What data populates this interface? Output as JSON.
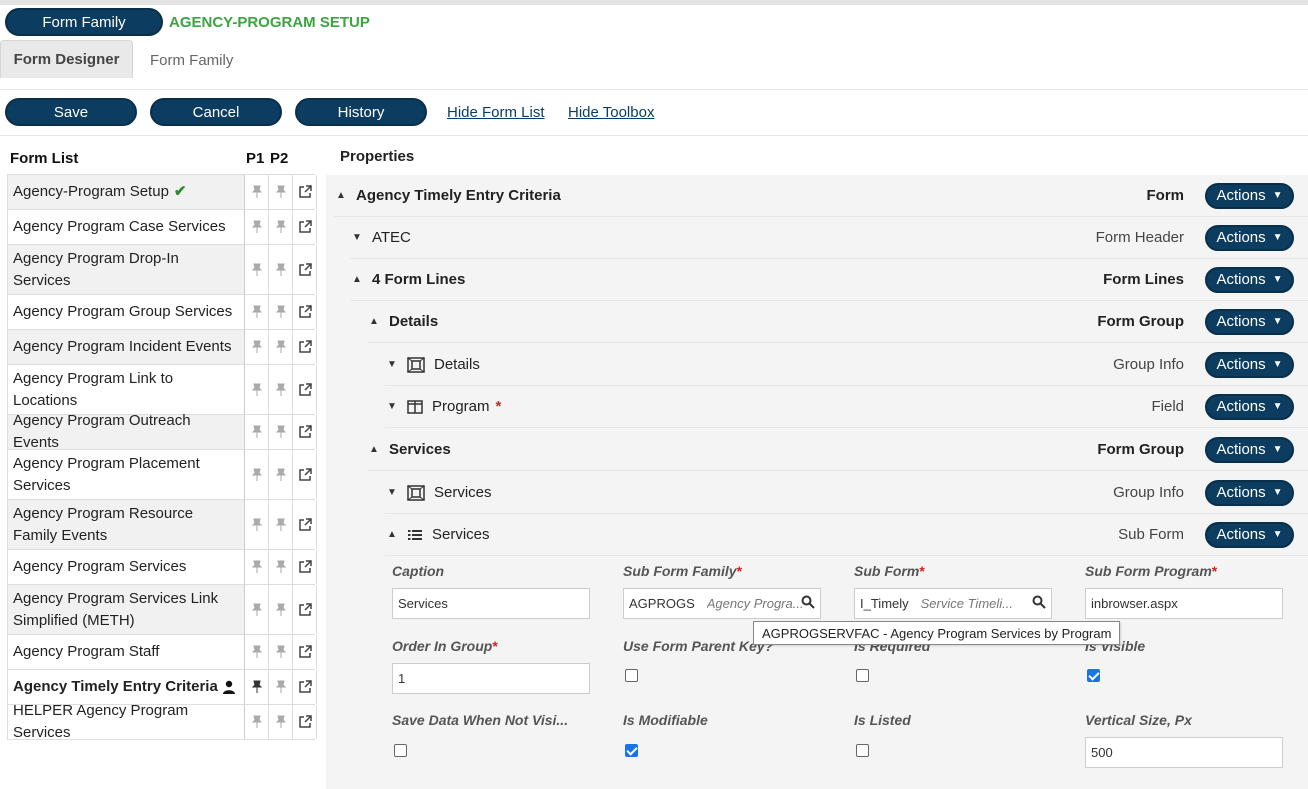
{
  "header": {
    "form_family_button": "Form Family",
    "title": "AGENCY-PROGRAM SETUP",
    "title_color": "#3aa541"
  },
  "tabs": [
    {
      "label": "Form Designer",
      "active": true
    },
    {
      "label": "Form Family",
      "active": false
    }
  ],
  "toolbar": {
    "save": "Save",
    "cancel": "Cancel",
    "history": "History",
    "hide_form_list": "Hide Form List",
    "hide_toolbox": "Hide Toolbox"
  },
  "form_list": {
    "header": "Form List",
    "col_p1": "P1",
    "col_p2": "P2",
    "items": [
      {
        "name": "Agency-Program Setup",
        "check": "✔"
      },
      {
        "name": "Agency Program Case Services"
      },
      {
        "name": "Agency Program Drop-In Services"
      },
      {
        "name": "Agency Program Group Services"
      },
      {
        "name": "Agency Program Incident Events"
      },
      {
        "name": "Agency Program Link to Locations"
      },
      {
        "name": "Agency Program Outreach Events"
      },
      {
        "name": "Agency Program Placement Services"
      },
      {
        "name": "Agency Program Resource Family Events"
      },
      {
        "name": "Agency Program Services"
      },
      {
        "name": "Agency Program Services Link Simplified (METH)"
      },
      {
        "name": "Agency Program Staff"
      },
      {
        "name": "Agency Timely Entry Criteria",
        "selected": true
      },
      {
        "name": "HELPER Agency Program Services"
      }
    ]
  },
  "properties": {
    "title": "Properties",
    "actions_label": "Actions",
    "tree": [
      {
        "label": "Agency Timely Entry Criteria",
        "type": "Form"
      },
      {
        "label": "ATEC",
        "type": "Form Header"
      },
      {
        "label": "4 Form Lines",
        "type": "Form Lines"
      },
      {
        "label": "Details",
        "type": "Form Group"
      },
      {
        "label": "Details",
        "type": "Group Info"
      },
      {
        "label": "Program",
        "type": "Field",
        "required_mark": "*"
      },
      {
        "label": "Services",
        "type": "Form Group"
      },
      {
        "label": "Services",
        "type": "Group Info"
      },
      {
        "label": "Services",
        "type": "Sub Form"
      }
    ],
    "subform": {
      "caption_label": "Caption",
      "caption_value": "Services",
      "sub_form_family_label": "Sub Form Family",
      "sub_form_family_code": "AGPROGS",
      "sub_form_family_hint": "Agency Progra...",
      "sub_form_label": "Sub Form",
      "sub_form_code": "I_Timely",
      "sub_form_hint": "Service Timeli...",
      "sub_form_program_label": "Sub Form Program",
      "sub_form_program_value": "inbrowser.aspx",
      "order_label": "Order In Group",
      "order_value": "1",
      "use_parent_key_label": "Use Form Parent Key?",
      "is_required_label": "Is Required",
      "is_visible_label": "Is Visible",
      "save_not_visible_label": "Save Data When Not Visi...",
      "is_modifiable_label": "Is Modifiable",
      "is_listed_label": "Is Listed",
      "vertical_size_label": "Vertical Size, Px",
      "vertical_size_value": "500",
      "required_star": "*",
      "tooltip": "AGPROGSERVFAC - Agency Program Services by Program"
    }
  },
  "colors": {
    "primary": "#0c3c5f",
    "accent": "#3aa541",
    "required": "#d21f1f"
  }
}
